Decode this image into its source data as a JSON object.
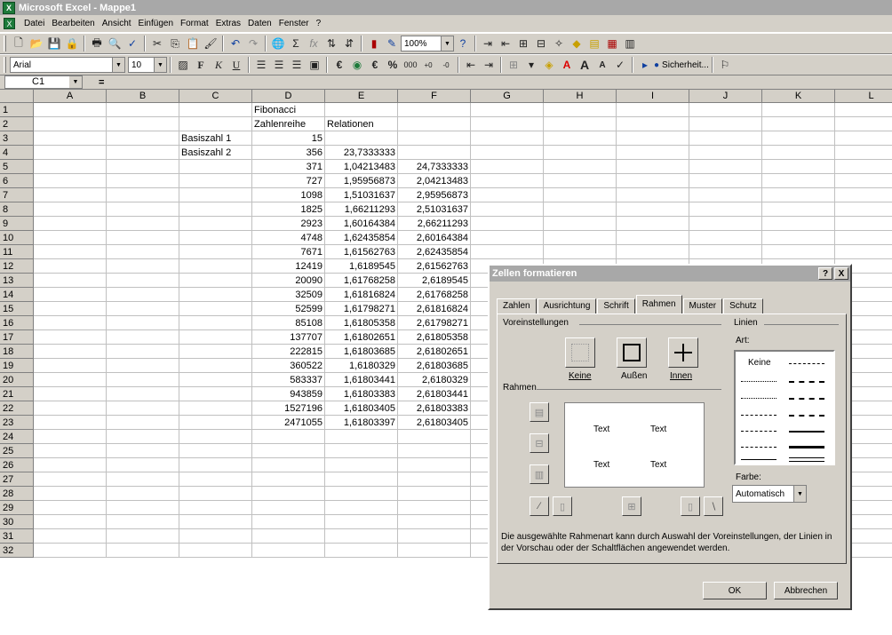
{
  "window": {
    "title": "Microsoft Excel - Mappe1",
    "icon": "excel-icon"
  },
  "menu": [
    "Datei",
    "Bearbeiten",
    "Ansicht",
    "Einfügen",
    "Format",
    "Extras",
    "Daten",
    "Fenster",
    "?"
  ],
  "toolbar1": {
    "zoom": "100%"
  },
  "toolbar2": {
    "font": "Arial",
    "size": "10",
    "bold": "F",
    "italic": "K",
    "underline": "U",
    "security": "Sicherheit..."
  },
  "formula": {
    "namebox": "C1",
    "equals": "="
  },
  "columns": [
    "A",
    "B",
    "C",
    "D",
    "E",
    "F",
    "G",
    "H",
    "I",
    "J",
    "K",
    "L"
  ],
  "rows": [
    "1",
    "2",
    "3",
    "4",
    "5",
    "6",
    "7",
    "8",
    "9",
    "10",
    "11",
    "12",
    "13",
    "14",
    "15",
    "16",
    "17",
    "18",
    "19",
    "20",
    "21",
    "22",
    "23",
    "24",
    "25",
    "26",
    "27",
    "28",
    "29",
    "30",
    "31",
    "32"
  ],
  "cells": {
    "D1": "Fibonacci",
    "D2": "Zahlenreihe",
    "E2": "Relationen",
    "C3": "Basiszahl 1",
    "C4": "Basiszahl 2"
  },
  "col_D": [
    "15",
    "356",
    "371",
    "727",
    "1098",
    "1825",
    "2923",
    "4748",
    "7671",
    "12419",
    "20090",
    "32509",
    "52599",
    "85108",
    "137707",
    "222815",
    "360522",
    "583337",
    "943859",
    "1527196",
    "2471055"
  ],
  "col_E": [
    "23,7333333",
    "1,04213483",
    "1,95956873",
    "1,51031637",
    "1,66211293",
    "1,60164384",
    "1,62435854",
    "1,61562763",
    "1,6189545",
    "1,61768258",
    "1,61816824",
    "1,61798271",
    "1,61805358",
    "1,61802651",
    "1,61803685",
    "1,6180329",
    "1,61803441",
    "1,61803383",
    "1,61803405",
    "1,61803397"
  ],
  "col_F": [
    "24,7333333",
    "2,04213483",
    "2,95956873",
    "2,51031637",
    "2,66211293",
    "2,60164384",
    "2,62435854",
    "2,61562763",
    "2,6189545",
    "2,61768258",
    "2,61816824",
    "2,61798271",
    "2,61805358",
    "2,61802651",
    "2,61803685",
    "2,6180329",
    "2,61803441",
    "2,61803383",
    "2,61803405"
  ],
  "dialog": {
    "title": "Zellen formatieren",
    "help": "?",
    "close": "X",
    "tabs": [
      "Zahlen",
      "Ausrichtung",
      "Schrift",
      "Rahmen",
      "Muster",
      "Schutz"
    ],
    "active_tab": "Rahmen",
    "presets_label": "Voreinstellungen",
    "preset_none": "Keine",
    "preset_outer": "Außen",
    "preset_inner": "Innen",
    "border_label": "Rahmen",
    "preview_text": "Text",
    "lines_label": "Linien",
    "style_label": "Art:",
    "style_none": "Keine",
    "color_label": "Farbe:",
    "color_value": "Automatisch",
    "hint": "Die ausgewählte Rahmenart kann durch Auswahl der Voreinstellungen, der Linien in der Vorschau oder der Schaltflächen angewendet werden.",
    "ok": "OK",
    "cancel": "Abbrechen"
  }
}
